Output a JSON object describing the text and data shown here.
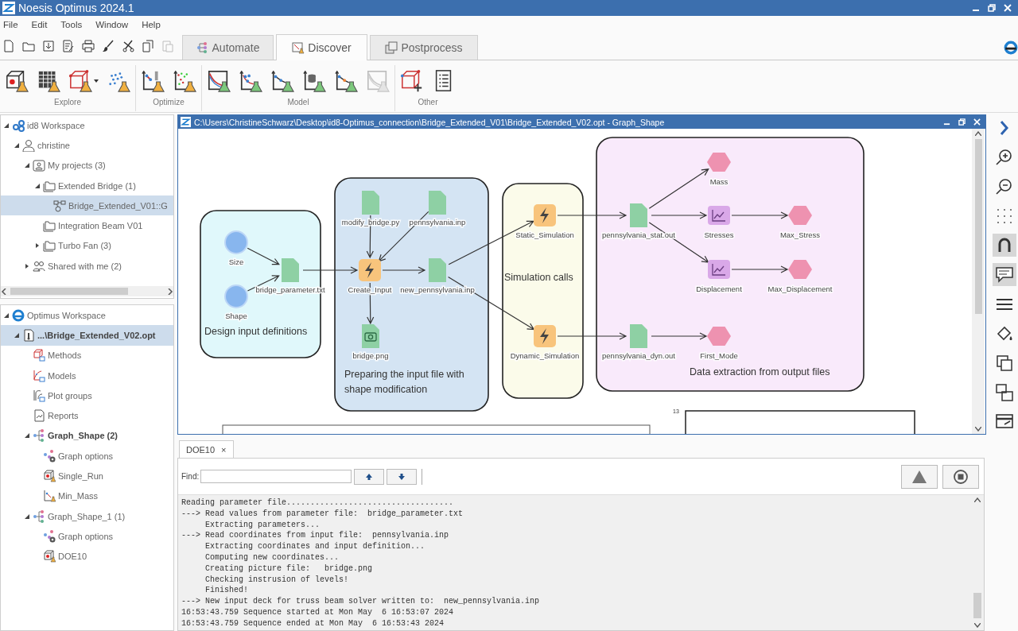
{
  "window": {
    "title": "Noesis Optimus 2024.1"
  },
  "menu": [
    "File",
    "Edit",
    "Tools",
    "Window",
    "Help"
  ],
  "quick_tools": [
    {
      "kind": "new",
      "disabled": false
    },
    {
      "kind": "open",
      "disabled": false
    },
    {
      "kind": "save",
      "disabled": false
    },
    {
      "kind": "edit",
      "disabled": false
    },
    {
      "kind": "print",
      "disabled": false
    },
    {
      "kind": "brush",
      "disabled": false
    },
    {
      "kind": "cut",
      "disabled": false
    },
    {
      "kind": "copy",
      "disabled": false
    },
    {
      "kind": "paste",
      "disabled": true
    }
  ],
  "tabs": [
    {
      "label": "Automate",
      "kind": "flow",
      "selected": false
    },
    {
      "label": "Discover",
      "kind": "chart",
      "selected": true
    },
    {
      "label": "Postprocess",
      "kind": "layers",
      "selected": false
    }
  ],
  "ribbon": [
    {
      "label": "Explore",
      "items": [
        {
          "kind": "doe",
          "disabled": false
        },
        {
          "kind": "table",
          "disabled": false
        },
        {
          "kind": "cube",
          "disabled": false
        },
        {
          "kind": "caret",
          "disabled": false
        },
        {
          "kind": "scatter",
          "disabled": false
        }
      ]
    },
    {
      "label": "Optimize",
      "items": [
        {
          "kind": "descent",
          "disabled": false
        },
        {
          "kind": "scatter2",
          "disabled": false
        }
      ]
    },
    {
      "label": "Model",
      "items": [
        {
          "kind": "curve",
          "disabled": false
        },
        {
          "kind": "points",
          "disabled": false
        },
        {
          "kind": "line",
          "disabled": false
        },
        {
          "kind": "db",
          "disabled": false
        },
        {
          "kind": "line2",
          "disabled": false
        },
        {
          "kind": "curve",
          "disabled": true
        }
      ]
    },
    {
      "label": "Other",
      "items": [
        {
          "kind": "cubeplus",
          "disabled": false
        },
        {
          "kind": "list",
          "disabled": false
        }
      ]
    }
  ],
  "workspace_tree": [
    {
      "label": "id8 Workspace",
      "kind": "id8",
      "selected": false,
      "active": false,
      "expanded": true,
      "children": [
        {
          "label": "christine",
          "kind": "user",
          "selected": false,
          "active": false,
          "expanded": true,
          "children": [
            {
              "label": "My projects (3)",
              "kind": "userfolder",
              "selected": false,
              "active": false,
              "expanded": true,
              "children": [
                {
                  "label": "Extended Bridge (1)",
                  "kind": "folder",
                  "selected": false,
                  "active": false,
                  "expanded": true,
                  "children": [
                    {
                      "label": "Bridge_Extended_V01::G",
                      "kind": "graph",
                      "selected": true,
                      "active": false
                    }
                  ]
                },
                {
                  "label": "Integration Beam V01",
                  "kind": "folder",
                  "selected": false,
                  "active": false
                },
                {
                  "label": "Turbo Fan (3)",
                  "kind": "folder",
                  "selected": false,
                  "active": false,
                  "expanded": false
                }
              ]
            },
            {
              "label": "Shared with me (2)",
              "kind": "shared",
              "selected": false,
              "active": false,
              "expanded": false
            }
          ]
        }
      ]
    }
  ],
  "optimus_tree": [
    {
      "label": "Optimus Workspace",
      "kind": "optimus",
      "selected": false,
      "active": false,
      "expanded": true,
      "children": [
        {
          "label": "...\\Bridge_Extended_V02.opt",
          "kind": "optfile",
          "selected": true,
          "active": true,
          "expanded": true,
          "children": [
            {
              "label": "Methods",
              "kind": "methods",
              "selected": false,
              "active": false
            },
            {
              "label": "Models",
              "kind": "models",
              "selected": false,
              "active": false
            },
            {
              "label": "Plot groups",
              "kind": "plots",
              "selected": false,
              "active": false
            },
            {
              "label": "Reports",
              "kind": "reports",
              "selected": false,
              "active": false
            },
            {
              "label": "Graph_Shape (2)",
              "kind": "graphshape",
              "selected": false,
              "active": true,
              "expanded": true,
              "children": [
                {
                  "label": "Graph options",
                  "kind": "graphoptions",
                  "selected": false,
                  "active": false
                },
                {
                  "label": "Single_Run",
                  "kind": "doe",
                  "selected": false,
                  "active": false
                },
                {
                  "label": "Min_Mass",
                  "kind": "optim",
                  "selected": false,
                  "active": false
                }
              ]
            },
            {
              "label": "Graph_Shape_1 (1)",
              "kind": "graphshape",
              "selected": false,
              "active": false,
              "expanded": true,
              "children": [
                {
                  "label": "Graph options",
                  "kind": "graphoptions",
                  "selected": false,
                  "active": false
                },
                {
                  "label": "DOE10",
                  "kind": "doe",
                  "selected": false,
                  "active": false
                }
              ]
            }
          ]
        }
      ]
    }
  ],
  "graph_window": {
    "title": "C:\\Users\\ChristineSchwarz\\Desktop\\id8-Optimus_connection\\Bridge_Extended_V01\\Bridge_Extended_V02.opt - Graph_Shape",
    "groups": [
      {
        "label": "Design input definitions",
        "color": "#e0f8fb"
      },
      {
        "label": "Preparing the input file with shape modification",
        "color": "#d4e4f3"
      },
      {
        "label": "Simulation calls",
        "color": "#fbfbea"
      },
      {
        "label": "Data extraction from output files",
        "color": "#f9eafb"
      }
    ],
    "nodes": [
      {
        "label": "Size",
        "kind": "parameter"
      },
      {
        "label": "Shape",
        "kind": "parameter"
      },
      {
        "label": "bridge_parameter.txt",
        "kind": "file"
      },
      {
        "label": "modify_bridge.py",
        "kind": "file"
      },
      {
        "label": "pennsylvania.inp",
        "kind": "file"
      },
      {
        "label": "Create_Input",
        "kind": "action"
      },
      {
        "label": "new_pennsylvania.inp",
        "kind": "file"
      },
      {
        "label": "bridge.png",
        "kind": "image"
      },
      {
        "label": "Static_Simulation",
        "kind": "action"
      },
      {
        "label": "Dynamic_Simulation",
        "kind": "action"
      },
      {
        "label": "pennsylvania_stat.out",
        "kind": "file"
      },
      {
        "label": "pennsylvania_dyn.out",
        "kind": "file"
      },
      {
        "label": "Mass",
        "kind": "response"
      },
      {
        "label": "Stresses",
        "kind": "chart"
      },
      {
        "label": "Max_Stress",
        "kind": "response"
      },
      {
        "label": "Displacement",
        "kind": "chart"
      },
      {
        "label": "Max_Displacement",
        "kind": "response"
      },
      {
        "label": "First_Mode",
        "kind": "response"
      }
    ],
    "partial_label": "13"
  },
  "side_tools": [
    {
      "kind": "chevron",
      "pressed": false
    },
    {
      "kind": "zoomin",
      "pressed": false
    },
    {
      "kind": "zoomout",
      "pressed": false
    },
    {
      "kind": "grid",
      "pressed": false
    },
    {
      "kind": "magnet",
      "pressed": true
    },
    {
      "kind": "comment",
      "pressed": true
    },
    {
      "kind": "menu",
      "pressed": false
    },
    {
      "kind": "bucket",
      "pressed": false
    },
    {
      "kind": "copy",
      "pressed": false
    },
    {
      "kind": "layers",
      "pressed": false
    },
    {
      "kind": "card",
      "pressed": false
    }
  ],
  "console": {
    "tabs": [
      {
        "label": "DOE10",
        "selected": true
      }
    ],
    "close_mark": "×",
    "find_label": "Find:",
    "log": [
      "Reading parameter file...................................",
      "---> Read values from parameter file:  bridge_parameter.txt",
      "     Extracting parameters...",
      "---> Read coordinates from input file:  pennsylvania.inp",
      "     Extracting coordinates and input definition...",
      "     Computing new coordinates...",
      "     Creating picture file:   bridge.png",
      "     Checking instrusion of levels!",
      "     Finished!",
      "---> New input deck for truss beam solver written to:  new_pennsylvania.inp",
      "16:53:43.759 Sequence started at Mon May  6 16:53:07 2024",
      "16:53:43.759 Sequence ended at Mon May  6 16:53:43 2024"
    ]
  }
}
